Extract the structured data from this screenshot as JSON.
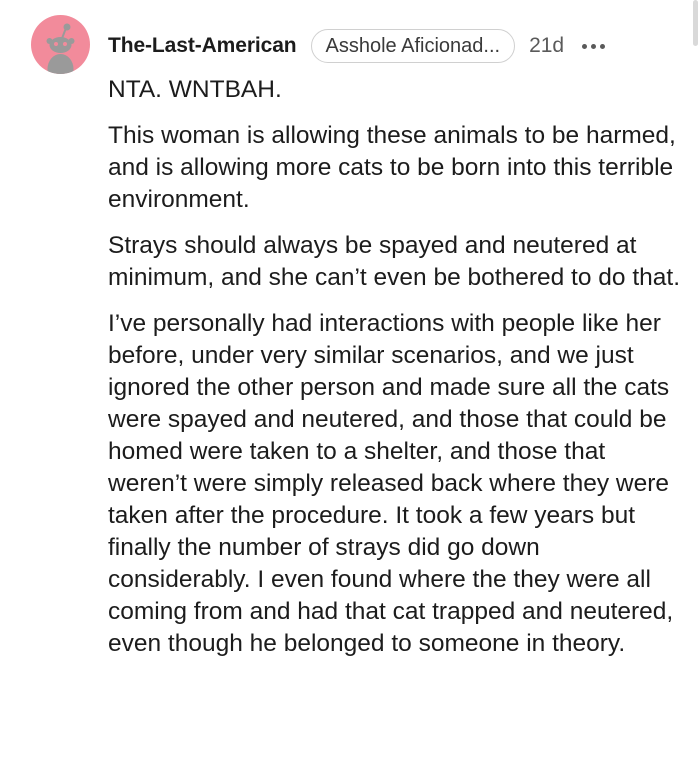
{
  "comment": {
    "username": "The-Last-American",
    "flair": "Asshole Aficionad...",
    "time": "21d",
    "avatar_color": "#f28b9b",
    "paragraphs": [
      "NTA. WNTBAH.",
      "This woman is allowing these animals to be harmed, and is allowing more cats to be born into this terrible environment.",
      "Strays should always be spayed and neutered at minimum, and she can’t even be bothered to do that.",
      "I’ve personally had interactions with people like her before, under very similar scenarios, and we just ignored the other person and made sure all the cats were spayed and neutered, and those that could be homed were taken to a shelter, and those that weren’t were simply released back where they were taken after the procedure. It took a few years but finally the number of strays did go down considerably. I even found where the they were all coming from and had that cat trapped and neutered, even though he belonged to someone in theory."
    ],
    "icons": {
      "avatar": "reddit-snoo-avatar-icon",
      "more": "more-options-icon"
    }
  }
}
